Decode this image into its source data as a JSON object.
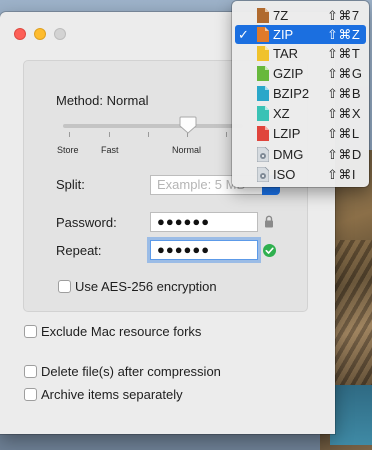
{
  "window": {
    "method_label": "Method: Normal",
    "slider": {
      "stops": [
        "Store",
        "Fast",
        "",
        "Normal",
        ""
      ],
      "selected": "Normal"
    },
    "split": {
      "label": "Split:",
      "placeholder": "Example: 5 MB"
    },
    "password": {
      "label": "Password:",
      "value": "●●●●●●"
    },
    "repeat": {
      "label": "Repeat:",
      "value": "●●●●●●"
    },
    "checkboxes": {
      "aes": "Use AES-256 encryption",
      "exclude_forks": "Exclude Mac resource forks",
      "delete_after": "Delete file(s) after compression",
      "archive_separately": "Archive items separately"
    }
  },
  "format_menu": {
    "selected": "ZIP",
    "items": [
      {
        "label": "7Z",
        "shortcut": "⇧⌘7",
        "icon": "7z-file-icon",
        "color": "#b06a2e"
      },
      {
        "label": "ZIP",
        "shortcut": "⇧⌘Z",
        "icon": "zip-file-icon",
        "color": "#e07a2a"
      },
      {
        "label": "TAR",
        "shortcut": "⇧⌘T",
        "icon": "tar-file-icon",
        "color": "#f0c22c"
      },
      {
        "label": "GZIP",
        "shortcut": "⇧⌘G",
        "icon": "gzip-file-icon",
        "color": "#67b83c"
      },
      {
        "label": "BZIP2",
        "shortcut": "⇧⌘B",
        "icon": "bzip2-file-icon",
        "color": "#2aa7c9"
      },
      {
        "label": "XZ",
        "shortcut": "⇧⌘X",
        "icon": "xz-file-icon",
        "color": "#3ac2b5"
      },
      {
        "label": "LZIP",
        "shortcut": "⇧⌘L",
        "icon": "lzip-file-icon",
        "color": "#e0443c"
      },
      {
        "label": "DMG",
        "shortcut": "⇧⌘D",
        "icon": "dmg-file-icon",
        "color": "#a7b0ba"
      },
      {
        "label": "ISO",
        "shortcut": "⇧⌘I",
        "icon": "iso-file-icon",
        "color": "#a7b0ba"
      }
    ]
  },
  "colors": {
    "accent": "#1b6fe0",
    "valid": "#2fb04f"
  }
}
